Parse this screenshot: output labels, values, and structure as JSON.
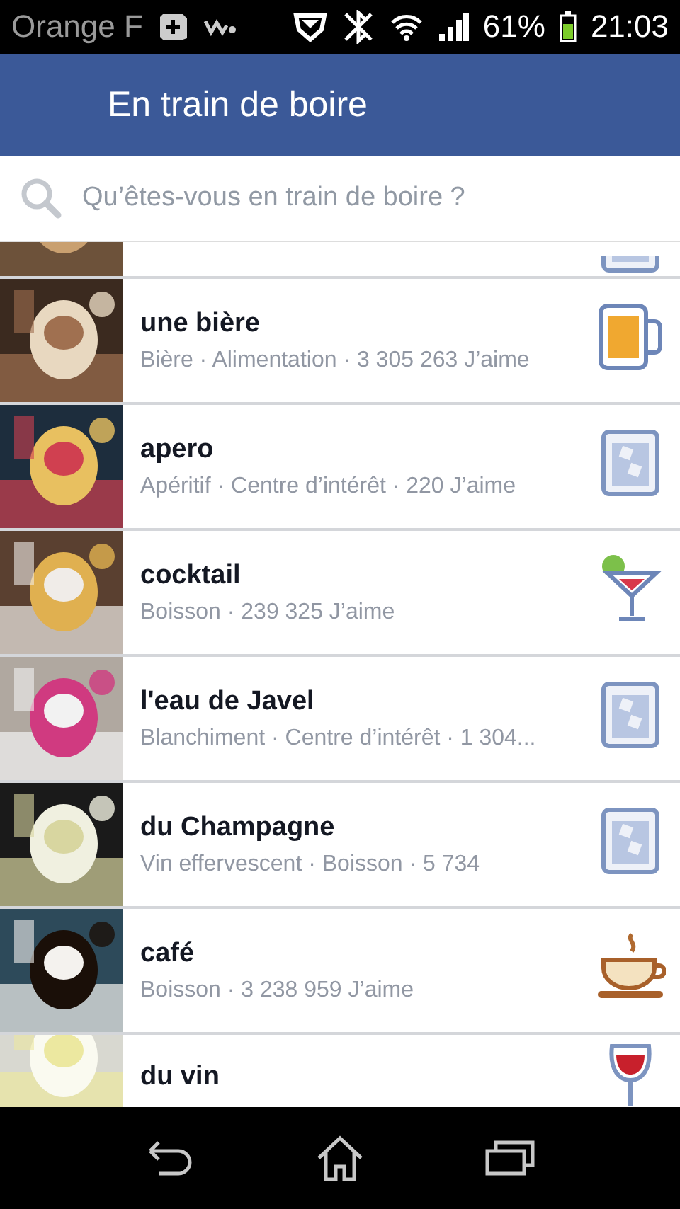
{
  "status_bar": {
    "carrier": "Orange F",
    "battery": "61%",
    "time": "21:03"
  },
  "header": {
    "title": "En train de boire"
  },
  "search": {
    "placeholder": "Qu’êtes-vous en train de boire ?"
  },
  "rows": [
    {
      "kind": "partial"
    },
    {
      "kind": "full",
      "title": "une bière",
      "subtitle": "Bière · Alimentation · 3 305 263 J’aime"
    },
    {
      "kind": "full",
      "title": "apero",
      "subtitle": "Apéritif · Centre d’intérêt · 220 J’aime"
    },
    {
      "kind": "full",
      "title": "cocktail",
      "subtitle": "Boisson · 239 325 J’aime"
    },
    {
      "kind": "full",
      "title": "l'eau de Javel",
      "subtitle": "Blanchiment · Centre d’intérêt · 1 304..."
    },
    {
      "kind": "full",
      "title": "du Champagne",
      "subtitle": "Vin effervescent · Boisson · 5 734"
    },
    {
      "kind": "full",
      "title": "café",
      "subtitle": "Boisson · 3 238 959 J’aime"
    },
    {
      "kind": "cut",
      "title": "du vin"
    }
  ]
}
